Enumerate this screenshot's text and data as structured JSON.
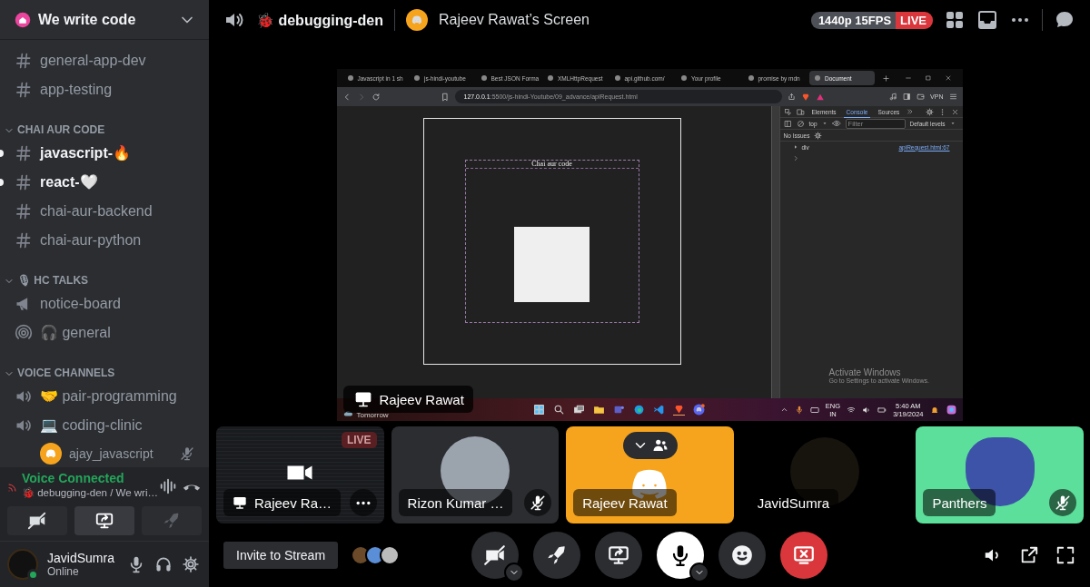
{
  "server": {
    "name": "We write code"
  },
  "channel_groups": [
    {
      "channels": [
        {
          "kind": "text",
          "name": "general-app-dev",
          "unread": false
        },
        {
          "kind": "text",
          "name": "app-testing",
          "unread": false
        }
      ]
    },
    {
      "name": "CHAI AUR CODE",
      "channels": [
        {
          "kind": "text",
          "name": "javascript-🔥",
          "unread": true
        },
        {
          "kind": "text",
          "name": "react-🤍",
          "unread": true
        },
        {
          "kind": "text",
          "name": "chai-aur-backend",
          "unread": false
        },
        {
          "kind": "text",
          "name": "chai-aur-python",
          "unread": false
        }
      ]
    },
    {
      "name": "🎙 HC TALKS",
      "channels": [
        {
          "kind": "announcement",
          "name": "notice-board",
          "unread": false
        },
        {
          "kind": "stage",
          "name": "🎧 general",
          "unread": false
        }
      ]
    },
    {
      "name": "VOICE CHANNELS",
      "channels": [
        {
          "kind": "voice",
          "name": "🤝 pair-programming",
          "unread": false
        },
        {
          "kind": "voice",
          "name": "💻 coding-clinic",
          "unread": false,
          "members": [
            {
              "name": "ajay_javascript",
              "muted": true
            }
          ]
        }
      ]
    }
  ],
  "voice_panel": {
    "status": "Voice Connected",
    "location": "🐞 debugging-den / We wri…",
    "buttons": [
      {
        "kind": "camera",
        "on": false
      },
      {
        "kind": "share",
        "on": true
      },
      {
        "kind": "activity",
        "on": false
      }
    ]
  },
  "user": {
    "name": "JavidSumra",
    "status": "Online"
  },
  "header": {
    "channel": "🐞 debugging-den",
    "stream": "Rajeev Rawat’s Screen",
    "quality": "1440p 15FPS",
    "live": "LIVE"
  },
  "screen": {
    "sharer": "Rajeev Rawat",
    "tabs": [
      {
        "title": "Javascript in 1 sh",
        "selected": false
      },
      {
        "title": "js-hindi-youtube",
        "selected": false
      },
      {
        "title": "Best JSON Forma",
        "selected": false
      },
      {
        "title": "XMLHttpRequest",
        "selected": false
      },
      {
        "title": "api.github.com/",
        "selected": false
      },
      {
        "title": "Your profile",
        "selected": false
      },
      {
        "title": "promise by mdn",
        "selected": false
      },
      {
        "title": "Document",
        "selected": true
      }
    ],
    "address": "**127.0.0.1**:5500/js-hindi-Youtube/09_advance/apiRequest.html",
    "vpn": "VPN",
    "page_heading": "Chai aur code",
    "devtools": {
      "tabs": [
        {
          "label": "Elements",
          "selected": false
        },
        {
          "label": "Console",
          "selected": true
        },
        {
          "label": "Sources",
          "selected": false
        }
      ],
      "context": "top",
      "filter_placeholder": "Filter",
      "levels": "Default levels",
      "issues": "No Issues",
      "log": [
        {
          "text": "div",
          "source": "apiRequest.html:67"
        }
      ]
    },
    "activation": {
      "title": "Activate Windows",
      "text": "Go to Settings to activate Windows."
    },
    "taskbar": {
      "weather": "Tomorrow",
      "language": "ENG",
      "region": "IN",
      "time": "5:40 AM",
      "date": "3/19/2024"
    }
  },
  "tiles": [
    {
      "kind": "stream",
      "name": "Rajeev Ra…",
      "live": "LIVE",
      "muted": false
    },
    {
      "kind": "photo",
      "name": "Rizon Kumar …",
      "muted": true
    },
    {
      "kind": "discord",
      "name": "Rajeev Rawat",
      "color": "#f6a41d",
      "muted": false,
      "focused": true
    },
    {
      "kind": "avatar",
      "name": "JavidSumra",
      "muted": false
    },
    {
      "kind": "avatar",
      "name": "Panthers",
      "color": "#5ddf9c",
      "muted": true
    }
  ],
  "controls": {
    "invite": "Invite to Stream",
    "buttons": [
      {
        "kind": "camera",
        "on": false
      },
      {
        "kind": "activity"
      },
      {
        "kind": "share"
      },
      {
        "kind": "mic",
        "on": true
      },
      {
        "kind": "emoji"
      },
      {
        "kind": "leave"
      }
    ]
  }
}
